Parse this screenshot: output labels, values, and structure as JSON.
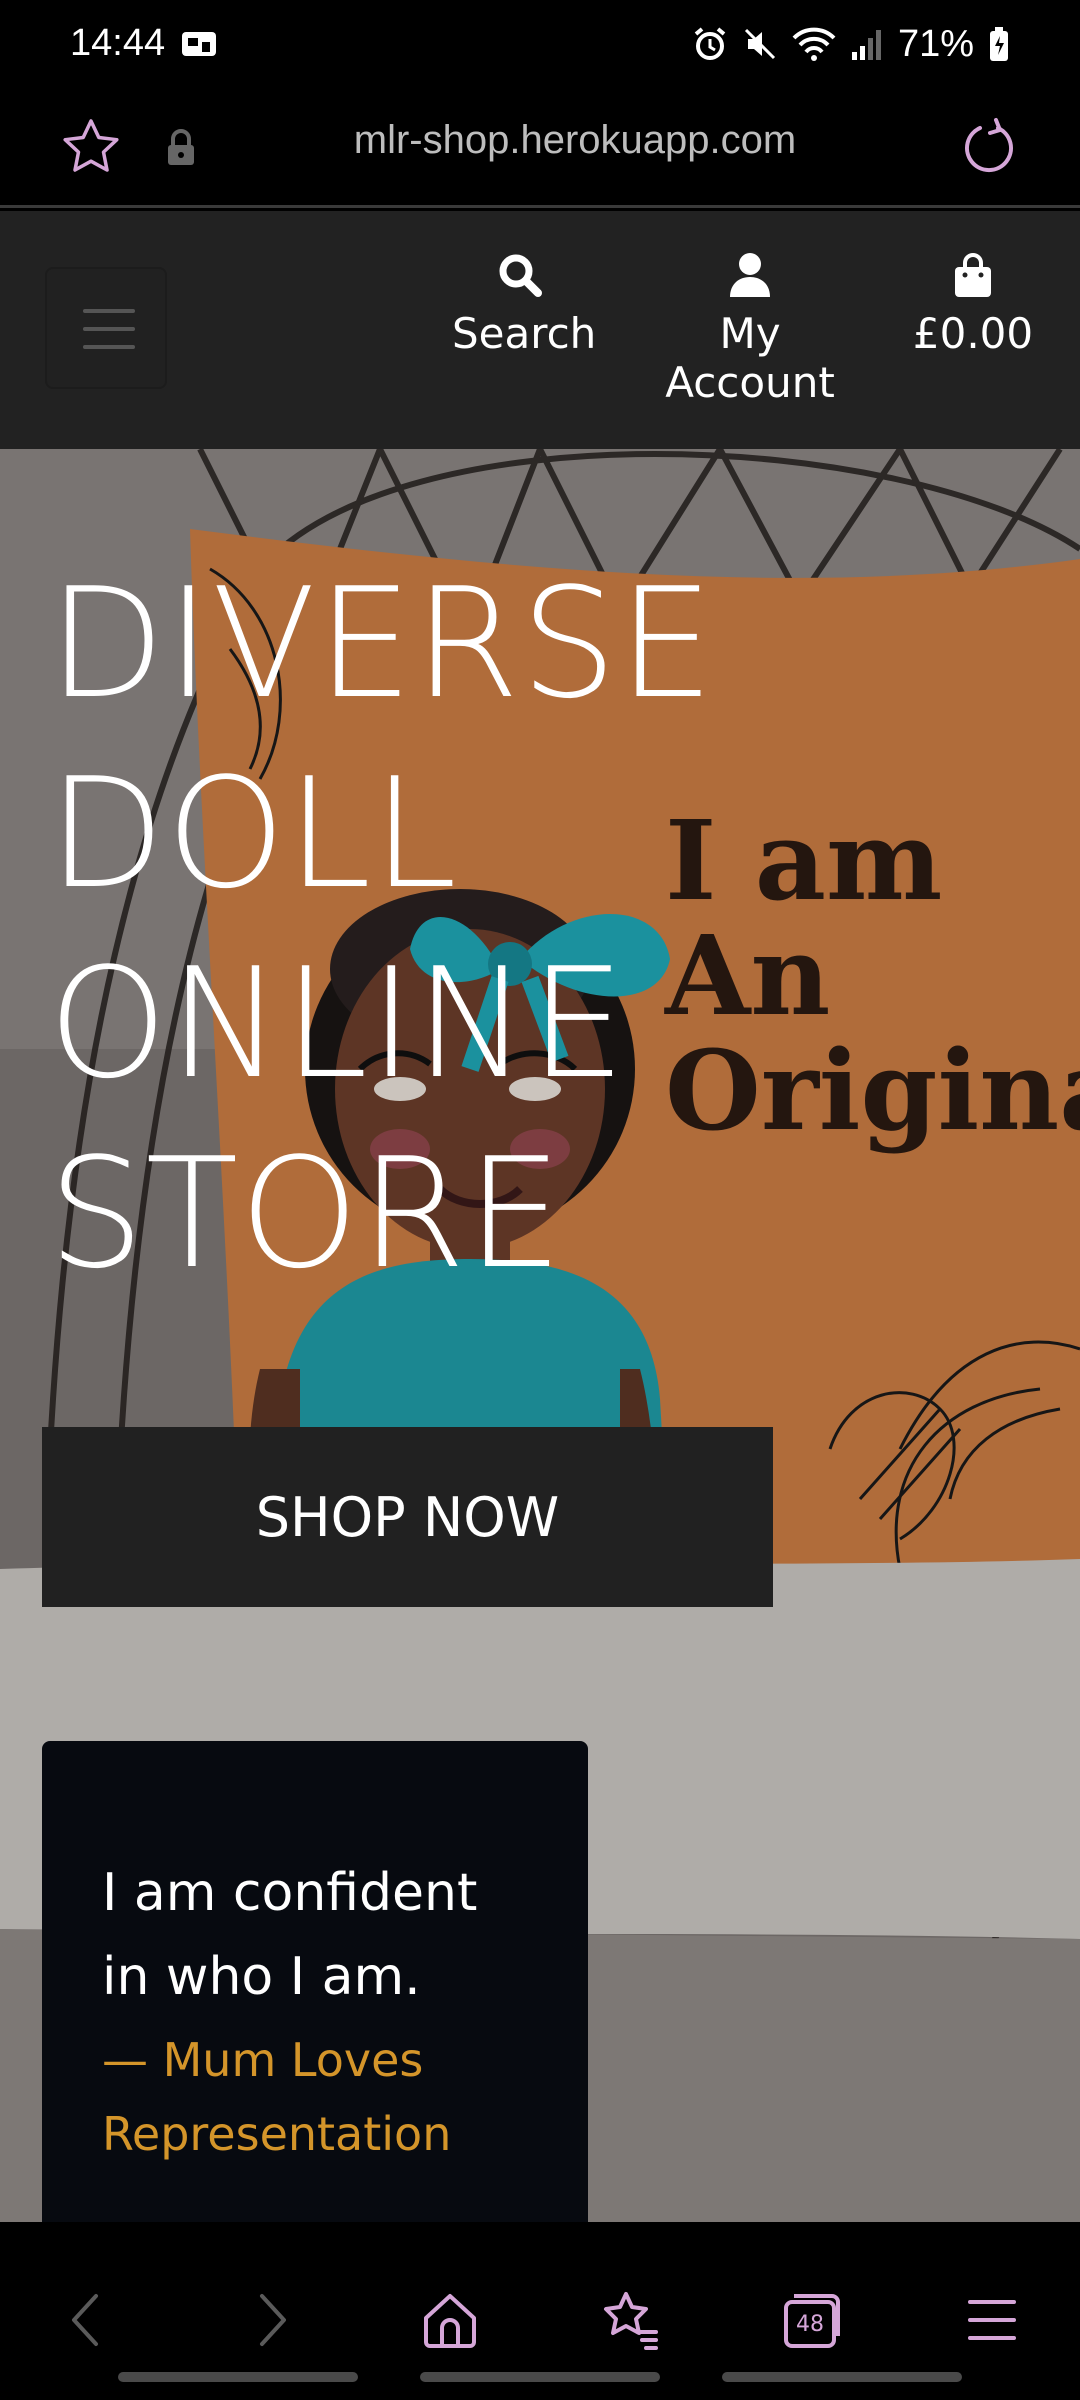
{
  "status_bar": {
    "time": "14:44",
    "battery": "71%"
  },
  "browser": {
    "url": "mlr-shop.herokuapp.com",
    "tab_count": "48",
    "accent_color": "#d5a6d8"
  },
  "header": {
    "nav": {
      "search_label": "Search",
      "account_label": "My Account",
      "cart_label": "£0.00"
    }
  },
  "hero": {
    "title_lines": [
      "DIVERSE",
      "DOLL",
      "ONLINE",
      "STORE"
    ],
    "shop_button": "SHOP NOW",
    "pillow_text": [
      "I am",
      "An",
      "Origina"
    ],
    "quote": {
      "text": "I am confident in who I am.",
      "author": "— Mum Loves Representation",
      "author_color": "#d4952a"
    }
  }
}
